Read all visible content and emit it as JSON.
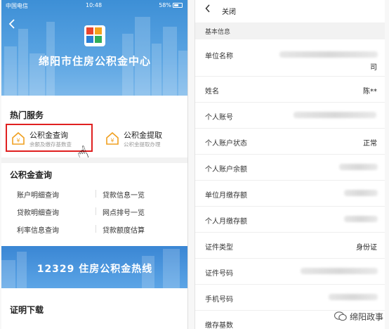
{
  "left": {
    "status_bar": {
      "carrier": "中国电信",
      "time": "10:48",
      "battery": "58%"
    },
    "hero_title": "绵阳市住房公积金中心",
    "hot_services": {
      "title": "热门服务",
      "items": [
        {
          "name": "公积金查询",
          "desc": "余额及缴存基数查"
        },
        {
          "name": "公积金提取",
          "desc": "公积金提取办理"
        }
      ]
    },
    "query_section": {
      "title": "公积金查询",
      "items": [
        "账户明细查询",
        "贷款信息一览",
        "贷款明细查询",
        "网点排号一览",
        "利率信息查询",
        "贷款额度估算"
      ]
    },
    "hotline_banner": "12329 住房公积金热线",
    "cert_download": "证明下载"
  },
  "right": {
    "header": {
      "close_label": "关闭"
    },
    "section_title": "基本信息",
    "rows": [
      {
        "label": "单位名称",
        "value": "司"
      },
      {
        "label": "姓名",
        "value": "陈**"
      },
      {
        "label": "个人账号",
        "value": ""
      },
      {
        "label": "个人账户状态",
        "value": "正常"
      },
      {
        "label": "个人账户余额",
        "value": ""
      },
      {
        "label": "单位月缴存额",
        "value": ""
      },
      {
        "label": "个人月缴存额",
        "value": ""
      },
      {
        "label": "证件类型",
        "value": "身份证"
      },
      {
        "label": "证件号码",
        "value": ""
      },
      {
        "label": "手机号码",
        "value": ""
      },
      {
        "label": "缴存基数",
        "value": ""
      }
    ]
  },
  "watermark": "绵阳政事",
  "colors": {
    "accent_blue": "#3d8fd6",
    "highlight_red": "#e02020",
    "icon_orange": "#f0a020"
  }
}
